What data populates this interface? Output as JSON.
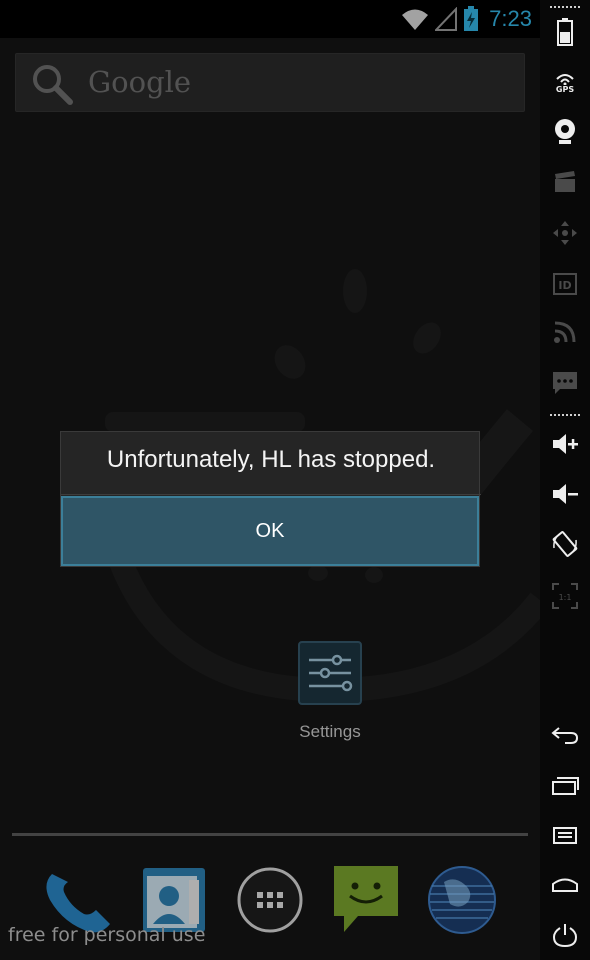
{
  "status_bar": {
    "time": "7:23",
    "icons": [
      "wifi-icon",
      "signal-icon",
      "battery-charging-icon"
    ],
    "accent_color": "#33b5e5"
  },
  "search": {
    "label": "Google"
  },
  "dialog": {
    "message": "Unfortunately, HL has stopped.",
    "ok_label": "OK"
  },
  "home": {
    "apps": [
      {
        "label": "Settings",
        "icon": "settings-icon"
      }
    ]
  },
  "dock": {
    "items": [
      "phone-icon",
      "contacts-icon",
      "all-apps-icon",
      "messaging-icon",
      "browser-globe-icon"
    ]
  },
  "watermark": "free for personal use",
  "side_panel": {
    "sensors": {
      "gps_label": "GPS",
      "id_label": "ID",
      "scale_label": "1:1"
    },
    "buttons": [
      "battery-icon",
      "gps-icon",
      "camera-icon",
      "media-clapper-icon",
      "remote-control-icon",
      "identity-icon",
      "rss-icon",
      "sms-icon",
      "volume-up-icon",
      "volume-down-icon",
      "rotate-icon",
      "pixel-perfect-icon",
      "back-icon",
      "recent-apps-icon",
      "menu-icon",
      "home-icon",
      "power-icon"
    ]
  }
}
